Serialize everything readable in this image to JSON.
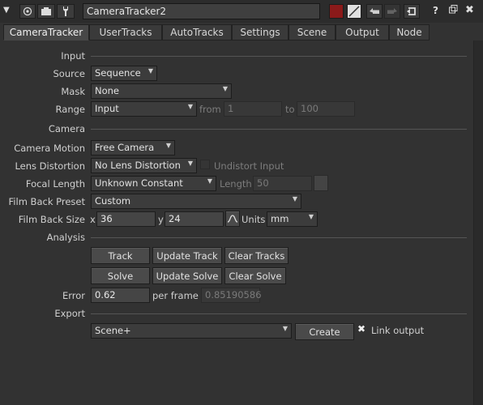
{
  "node": {
    "name": "CameraTracker2"
  },
  "tabs": [
    "CameraTracker",
    "UserTracks",
    "AutoTracks",
    "Settings",
    "Scene",
    "Output",
    "Node"
  ],
  "sections": {
    "input": "Input",
    "camera": "Camera",
    "analysis": "Analysis",
    "export": "Export"
  },
  "fields": {
    "source": {
      "label": "Source",
      "value": "Sequence"
    },
    "mask": {
      "label": "Mask",
      "value": "None"
    },
    "range": {
      "label": "Range",
      "value": "Input",
      "from_label": "from",
      "from_value": "1",
      "to_label": "to",
      "to_value": "100"
    },
    "camera_motion": {
      "label": "Camera Motion",
      "value": "Free Camera"
    },
    "lens_distortion": {
      "label": "Lens Distortion",
      "value": "No Lens Distortion",
      "undistort_label": "Undistort Input"
    },
    "focal_length": {
      "label": "Focal Length",
      "value": "Unknown Constant",
      "length_label": "Length",
      "length_value": "50"
    },
    "film_back_preset": {
      "label": "Film Back Preset",
      "value": "Custom"
    },
    "film_back_size": {
      "label": "Film Back Size",
      "x_label": "x",
      "x_value": "36",
      "y_label": "y",
      "y_value": "24",
      "units_label": "Units",
      "units_value": "mm"
    },
    "error": {
      "label": "Error",
      "value": "0.62",
      "per_frame_label": "per frame",
      "per_frame_value": "0.85190586"
    },
    "export": {
      "value": "Scene+",
      "create_label": "Create",
      "link_label": "Link output",
      "link_checked": true
    }
  },
  "buttons": {
    "track": "Track",
    "update_track": "Update Track",
    "clear_tracks": "Clear Tracks",
    "solve": "Solve",
    "update_solve": "Update Solve",
    "clear_solve": "Clear Solve"
  },
  "toolbar": {
    "help": "?"
  },
  "colors": {
    "node_color": "#8b1a1a",
    "background": "#323232"
  }
}
